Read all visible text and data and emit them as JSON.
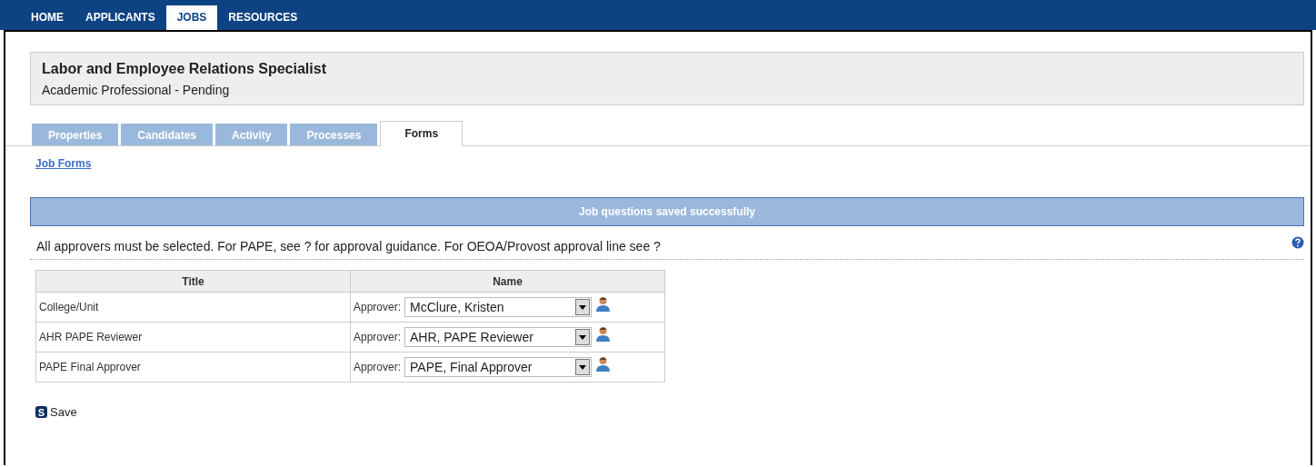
{
  "nav": [
    {
      "label": "HOME",
      "selected": false
    },
    {
      "label": "APPLICANTS",
      "selected": false
    },
    {
      "label": "JOBS",
      "selected": true
    },
    {
      "label": "RESOURCES",
      "selected": false
    }
  ],
  "job": {
    "title": "Labor and Employee Relations Specialist",
    "subtitle": "Academic Professional - Pending"
  },
  "tabs": [
    {
      "label": "Properties",
      "selected": false
    },
    {
      "label": "Candidates",
      "selected": false
    },
    {
      "label": "Activity",
      "selected": false
    },
    {
      "label": "Processes",
      "selected": false
    },
    {
      "label": "Forms",
      "selected": true
    }
  ],
  "link": "Job Forms",
  "banner": "Job questions saved successfully",
  "instructions": "All approvers must be selected. For PAPE, see ? for approval guidance. For OEOA/Provost approval line see ?",
  "table": {
    "columns": [
      "Title",
      "Name"
    ],
    "rows": [
      {
        "title": "College/Unit",
        "label": "Approver:",
        "value": "McClure, Kristen"
      },
      {
        "title": "AHR PAPE Reviewer",
        "label": "Approver:",
        "value": "AHR, PAPE Reviewer"
      },
      {
        "title": "PAPE Final Approver",
        "label": "Approver:",
        "value": "PAPE, Final Approver"
      }
    ]
  },
  "save": {
    "key": "S",
    "label": "Save"
  }
}
